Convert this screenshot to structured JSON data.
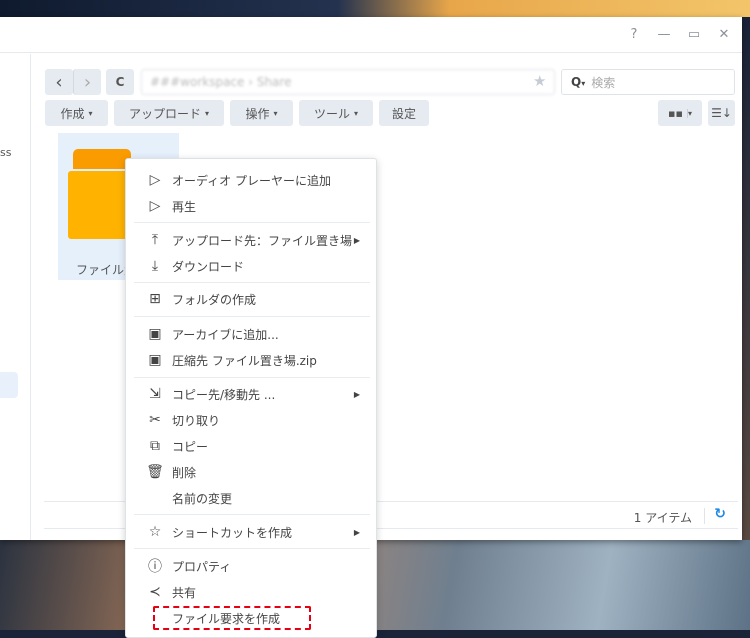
{
  "window": {
    "help": "?",
    "minimize": "—",
    "maximize": "▭",
    "close": "✕"
  },
  "sidebar": {
    "partial_text": "ss"
  },
  "nav": {
    "back": "‹",
    "forward": "›",
    "refresh": "C",
    "path": "###workspace › Share",
    "search_placeholder": "検索"
  },
  "toolbar": {
    "create": "作成",
    "upload": "アップロード",
    "action": "操作",
    "tools": "ツール",
    "settings": "設定"
  },
  "file": {
    "name": "ファイル置き場"
  },
  "status": {
    "count": "1 アイテム"
  },
  "menu": {
    "items": [
      {
        "label": "オーディオ プレーヤーに追加",
        "icon": "▷"
      },
      {
        "label": "再生",
        "icon": "▷"
      },
      {
        "label": "アップロード先：ファイル置き場",
        "icon": "⤒",
        "sub": true
      },
      {
        "label": "ダウンロード",
        "icon": "⤓"
      },
      {
        "label": "フォルダの作成",
        "icon": "⊞"
      },
      {
        "label": "アーカイブに追加...",
        "icon": "▣"
      },
      {
        "label": "圧縮先 ファイル置き場.zip",
        "icon": "▣"
      },
      {
        "label": "コピー先/移動先 ...",
        "icon": "⇲",
        "sub": true
      },
      {
        "label": "切り取り",
        "icon": "✂"
      },
      {
        "label": "コピー",
        "icon": "⧉"
      },
      {
        "label": "削除",
        "icon": "🗑"
      },
      {
        "label": "名前の変更",
        "icon": ""
      },
      {
        "label": "ショートカットを作成",
        "icon": "☆",
        "sub": true
      },
      {
        "label": "プロパティ",
        "icon": "ⓘ"
      },
      {
        "label": "共有",
        "icon": "≺"
      },
      {
        "label": "ファイル要求を作成",
        "icon": ""
      }
    ]
  },
  "colors": {
    "accent": "#1e88e5",
    "folder": "#ffb300",
    "highlight": "#e60012"
  }
}
